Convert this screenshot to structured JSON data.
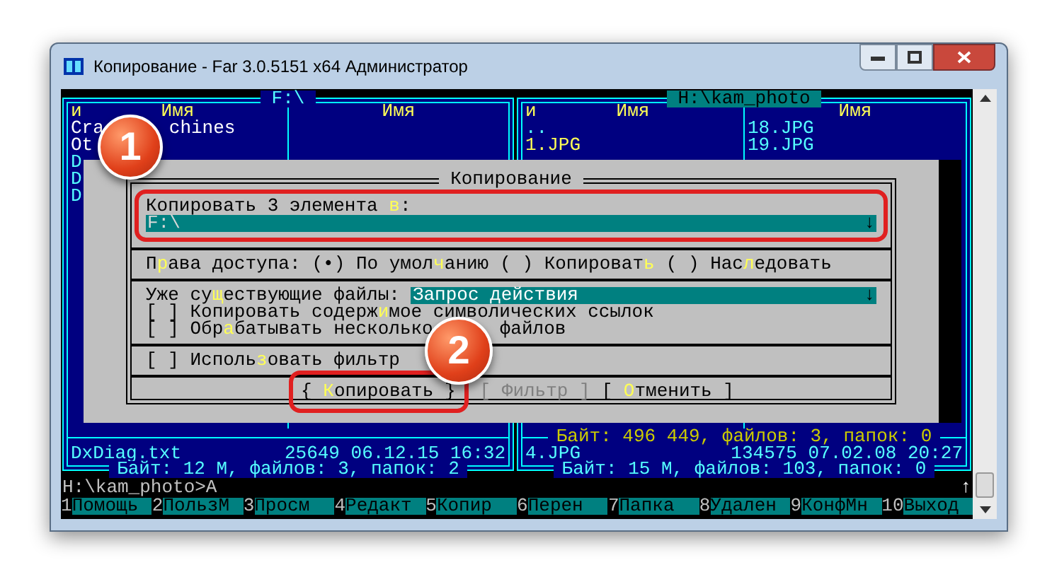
{
  "window": {
    "title": "Копирование - Far 3.0.5151 x64 Администратор"
  },
  "left_panel": {
    "title": "F:\\",
    "active": false,
    "columns": [
      "и",
      "Имя",
      "Имя"
    ],
    "files": [
      {
        "visible_parts": [
          "Cra",
          "chines"
        ],
        "color": "#ffffff"
      },
      {
        "visible_parts": [
          "Ot"
        ],
        "color": "#ffffff"
      },
      {
        "visible_parts": [
          "D"
        ],
        "color": "#55ffff"
      },
      {
        "visible_parts": [
          "D"
        ],
        "color": "#55ffff"
      },
      {
        "visible_parts": [
          "D"
        ],
        "color": "#55ffff"
      }
    ],
    "current_file": {
      "name": "DxDiag.txt",
      "size": "25649",
      "date": "06.12.15",
      "time": "16:32"
    },
    "totals": "Байт: 12 М, файлов: 3, папок: 2"
  },
  "right_panel": {
    "title": "H:\\kam_photo",
    "active": true,
    "columns": [
      "и",
      "Имя",
      "Имя"
    ],
    "files": [
      {
        "visible_parts": [
          ".."
        ],
        "color": "#55ffff"
      },
      {
        "visible_parts": [
          "1.JPG"
        ],
        "color": "#ffff55"
      }
    ],
    "files_col2": [
      {
        "visible_parts": [
          "18.JPG"
        ],
        "color": "#55ffff"
      },
      {
        "visible_parts": [
          "19.JPG"
        ],
        "color": "#55ffff"
      }
    ],
    "selection_totals": "Байт: 496 449, файлов: 3, папок: 0",
    "current_file": {
      "name": "4.JPG",
      "size": "134575",
      "date": "07.02.08",
      "time": "20:27"
    },
    "totals": "Байт: 15 М, файлов: 103, папок: 0"
  },
  "dialog": {
    "title": "Копирование",
    "target_label": {
      "pre": "Копировать 3 элемента ",
      "key": "в",
      "post": ":"
    },
    "target_value": "F:\\",
    "dropdown_arrow": "↓",
    "access_label": {
      "pre": "П",
      "key": "р",
      "post": "ава доступа:"
    },
    "access_options": [
      {
        "marker": "(•)",
        "label": {
          "pre": "По умол",
          "key": "ч",
          "post": "анию"
        }
      },
      {
        "marker": "( )",
        "label": {
          "pre": "Копироват",
          "key": "ь"
        }
      },
      {
        "marker": "( )",
        "label": {
          "pre": "Нас",
          "key": "л",
          "post": "едовать"
        }
      }
    ],
    "existing_label": {
      "pre": "Уже су",
      "key": "щ",
      "post": "ествующие файлы:"
    },
    "existing_value": "Запрос действия",
    "existing_arrow": "↓",
    "checkboxes": [
      {
        "marker": "[ ]",
        "label": {
          "pre": "Копировать содерж",
          "key": "и",
          "post": "мое символических ссылок"
        }
      },
      {
        "marker": "[ ]",
        "label": {
          "pre": "Обр",
          "key": "а",
          "post": "батывать несколько"
        },
        "after_badge": "файлов"
      }
    ],
    "filter_checkbox": {
      "marker": "[ ]",
      "label": {
        "pre": "Исполь",
        "key": "з",
        "post": "овать фильтр"
      }
    },
    "buttons": [
      {
        "open": "{",
        "label": {
          "key": "К",
          "post": "опировать"
        },
        "close": "}",
        "disabled": false
      },
      {
        "open": "[",
        "label": {
          "pre": "Фильтр"
        },
        "close": "]",
        "disabled": true
      },
      {
        "open": "[",
        "label": {
          "key": "О",
          "post": "тменить"
        },
        "close": "]",
        "disabled": false
      }
    ]
  },
  "command_line": {
    "text": "H:\\kam_photo>A",
    "history_arrow": "↑"
  },
  "keybar": [
    {
      "num": "1",
      "label": "Помощь"
    },
    {
      "num": "2",
      "label": "ПользМ"
    },
    {
      "num": "3",
      "label": "Просм"
    },
    {
      "num": "4",
      "label": "Редакт"
    },
    {
      "num": "5",
      "label": "Копир"
    },
    {
      "num": "6",
      "label": "Перен"
    },
    {
      "num": "7",
      "label": "Папка"
    },
    {
      "num": "8",
      "label": "Удален"
    },
    {
      "num": "9",
      "label": "КонфМн"
    },
    {
      "num": "10",
      "label": "Выход"
    }
  ],
  "annotations": [
    {
      "label": "1"
    },
    {
      "label": "2"
    }
  ]
}
